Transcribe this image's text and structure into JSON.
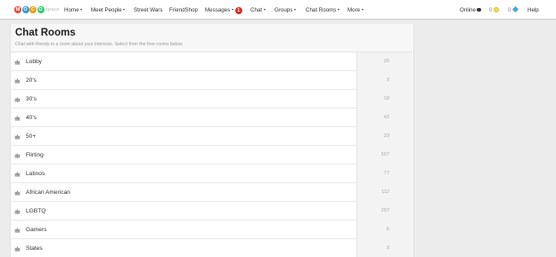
{
  "nav": {
    "logo": {
      "letters": [
        {
          "char": "M",
          "color": "#e74c3c"
        },
        {
          "char": "O",
          "color": "#3498db"
        },
        {
          "char": "C",
          "color": "#f39c12"
        },
        {
          "char": "O",
          "color": "#2ecc71"
        }
      ],
      "rest": "space"
    },
    "home": "Home",
    "meet_people": "Meet People",
    "street_wars": "Street Wars",
    "friendshop": "FriendShop",
    "messages": "Messages",
    "messages_badge": "1",
    "chat": "Chat",
    "groups": "Groups",
    "chat_rooms": "Chat Rooms",
    "more": "More",
    "online": "Online",
    "coins": "0",
    "gems": "0",
    "help": "Help"
  },
  "page": {
    "title": "Chat Rooms",
    "subtitle": "Chat with friends in a room about your interests. Select from the free rooms below"
  },
  "rooms": [
    {
      "name": "Lobby",
      "count": "26"
    },
    {
      "name": "20's",
      "count": "9"
    },
    {
      "name": "30's",
      "count": "18"
    },
    {
      "name": "40's",
      "count": "42"
    },
    {
      "name": "50+",
      "count": "23"
    },
    {
      "name": "Flirting",
      "count": "507"
    },
    {
      "name": "Latinos",
      "count": "77"
    },
    {
      "name": "African American",
      "count": "112"
    },
    {
      "name": "LGBTQ",
      "count": "297"
    },
    {
      "name": "Gamers",
      "count": "6"
    },
    {
      "name": "States",
      "count": "9"
    }
  ],
  "colors": {
    "badge": "#d9302c",
    "coin": "#f8d850",
    "gem": "#4aa3df",
    "row_count_bg": "#f3f3f3"
  },
  "icons": {
    "room": "crown-icon",
    "online": "status-dot-icon",
    "coins": "coin-icon",
    "gems": "gem-icon"
  }
}
